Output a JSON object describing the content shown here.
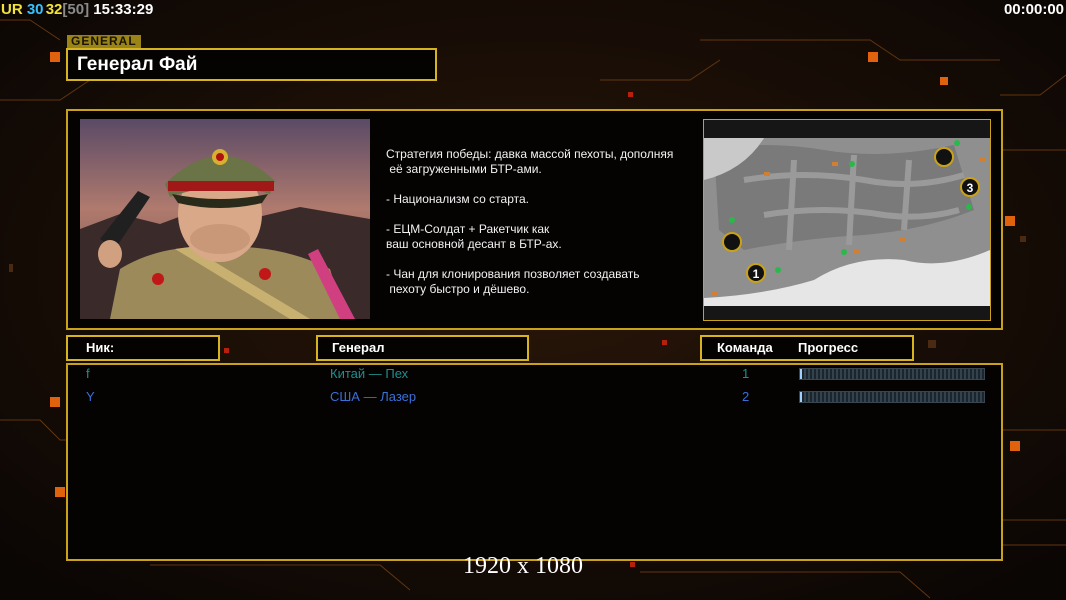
{
  "hud": {
    "label_ur": "UR",
    "val_a": "30",
    "val_b": "32",
    "val_c": "[50]",
    "clock": "15:33:29",
    "timer": "00:00:00"
  },
  "general_tag": "GENERAL",
  "general_name": "Генерал Фай",
  "description": [
    "Стратегия победы: давка массой пехоты, дополняя",
    " её загруженными БТР-ами.",
    "",
    "- Национализм со старта.",
    "",
    "- ЕЦМ-Солдат + Ракетчик как",
    "ваш основной десант в БТР-ах.",
    "",
    "- Чан для клонирования позволяет создавать",
    " пехоту быстро и дёшево."
  ],
  "map": {
    "spawn_labels": [
      "1",
      "3"
    ]
  },
  "columns": {
    "nick": "Ник:",
    "general": "Генерал",
    "team": "Команда",
    "progress": "Прогресс"
  },
  "players": [
    {
      "nick": "f",
      "general": "Китай — Пех",
      "team": "1",
      "progress": 0.01,
      "color": "#1f8f8f"
    },
    {
      "nick": "Y",
      "general": "США — Лазер",
      "team": "2",
      "progress": 0.01,
      "color": "#3a6fd8"
    }
  ],
  "resolution": "1920 x 1080",
  "colors": {
    "frame": "#d8b320",
    "hud_ur": "#f2e23a",
    "hud_a": "#35c2ff",
    "hud_b": "#f2e23a",
    "hud_c": "#8a8a8a",
    "accent": "#ff7a10"
  }
}
